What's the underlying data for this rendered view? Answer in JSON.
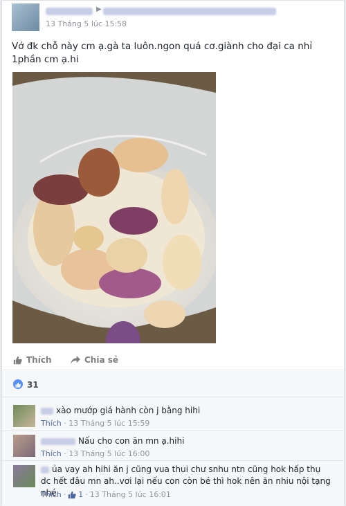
{
  "post": {
    "timestamp": "13 Tháng 5 lúc 15:58",
    "text": "Vớ đk chỗ này cm ạ.gà ta luôn.ngon quá cơ.giành cho đại ca nhỉ 1phần cm ạ.hi"
  },
  "actions": {
    "like_label": "Thích",
    "share_label": "Chia sẻ"
  },
  "reactions": {
    "count": "31"
  },
  "comments": [
    {
      "text": "xào mướp giá hành còn j bằng hihi",
      "like_label": "Thích",
      "timestamp": "13 Tháng 5 lúc 15:59"
    },
    {
      "text": "Nấu cho con ăn mn ạ.hihi",
      "like_label": "Thích",
      "timestamp": "13 Tháng 5 lúc 16:00"
    },
    {
      "text": "ủa vay ah hihi ăn j cũng vua thui chư snhu ntn cũng hok hấp thụ dc hết đâu mn ah..vơi lại nếu con còn bé thì hok nên ăn nhiu nội tạng nhé",
      "like_label": "Thích",
      "like_count": "1",
      "timestamp": "13 Tháng 5 lúc 16:01"
    }
  ],
  "colors": {
    "link": "#4b67a1",
    "like_blue": "#5890ff",
    "meta_gray": "#90949c"
  }
}
